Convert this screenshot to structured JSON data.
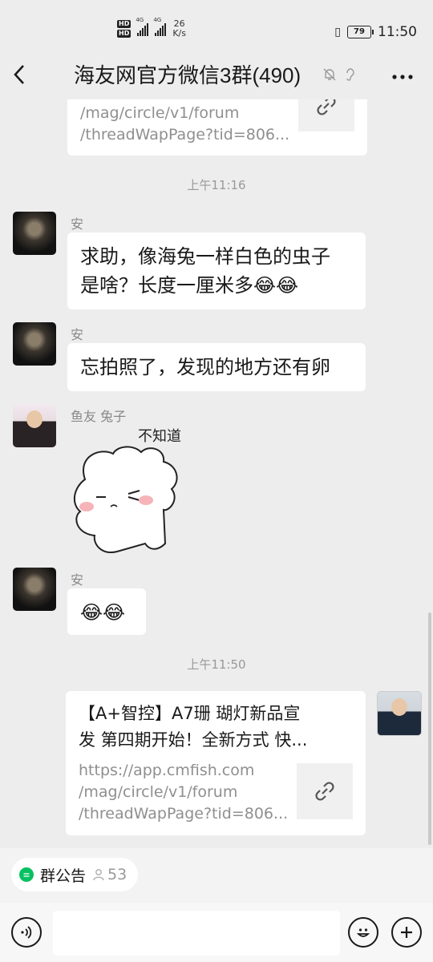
{
  "status": {
    "hd1": "HD",
    "hd2": "HD",
    "net1": "4G",
    "net2": "4G",
    "speed_value": "26",
    "speed_unit": "K/s",
    "battery": "79",
    "time": "11:50"
  },
  "header": {
    "back_icon": "chevron-left-icon",
    "title": "海友网官方微信3群(490)",
    "more_icon": "more-dots-icon"
  },
  "messages": {
    "top_card": {
      "url_line1": "/mag/circle/v1/forum",
      "url_line2": "/threadWapPage?tid=806..."
    },
    "ts1": "上午11:16",
    "m1": {
      "sender": "安",
      "line1": "求助，像海兔一样白色的虫子",
      "line2": "是啥？长度一厘米多😂😂"
    },
    "m2": {
      "sender": "安",
      "text": "忘拍照了，发现的地方还有卵"
    },
    "m3": {
      "sender": "鱼友 兔子",
      "sticker_text": "不知道"
    },
    "m4": {
      "sender": "安",
      "text": "😂😂"
    },
    "ts2": "上午11:50",
    "card": {
      "title_line1": "【A+智控】A7珊 瑚灯新品宣",
      "title_line2": "发 第四期开始！全新方式 快...",
      "url_line1": "https://app.cmfish.com",
      "url_line2": "/mag/circle/v1/forum",
      "url_line3": "/threadWapPage?tid=806..."
    }
  },
  "bottom": {
    "announcement_label": "群公告",
    "member_count": "53"
  }
}
